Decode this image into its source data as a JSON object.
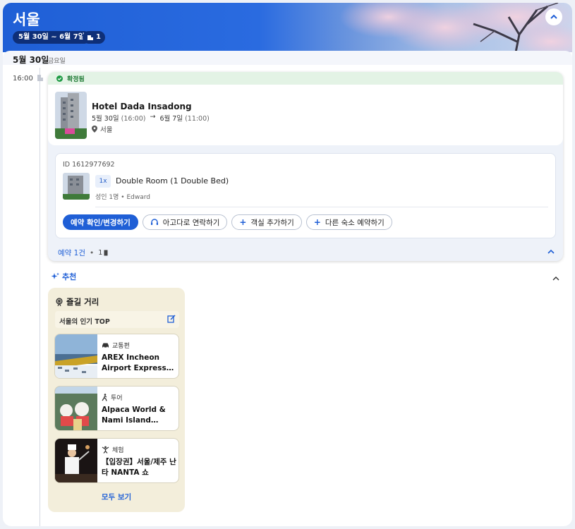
{
  "header": {
    "city": "서울",
    "date_range": "5월 30일 ~ 6월 7일",
    "rooms_count": "1"
  },
  "day": {
    "date": "5월 30일",
    "weekday": "금요일"
  },
  "timeline": {
    "time": "16:00"
  },
  "booking": {
    "status": "확정됨",
    "hotel_name": "Hotel Dada Insadong",
    "checkin_date": "5월 30일",
    "checkin_time": "(16:00)",
    "arrow": "→",
    "checkout_date": "6월 7일",
    "checkout_time": "(11:00)",
    "location": "서울",
    "reservation_id": "ID 1612977692",
    "room_qty": "1x",
    "room_name": "Double Room (1 Double Bed)",
    "guests": "성인 1명 • Edward",
    "buttons": {
      "confirm": "예약 확인/변경하기",
      "contact": "아고다로 연락하기",
      "add_room": "객실 추가하기",
      "other_stay": "다른 숙소 예약하기"
    },
    "count_label": "예약 1건",
    "count_dot": "•",
    "count_small": "1"
  },
  "recommend": {
    "title": "추천",
    "panel_title": "즐길 거리",
    "top_label": "서울의 인기 TOP",
    "items": [
      {
        "category": "교통편",
        "name": "AREX Incheon Airport Express…"
      },
      {
        "category": "투어",
        "name": "Alpaca World & Nami Island…"
      },
      {
        "category": "체험",
        "name": "【입장권】서울/제주 난타 NANTA 쇼"
      }
    ],
    "see_all": "모두 보기"
  },
  "colors": {
    "brand_blue": "#1f5fd6",
    "confirmed_green": "#1e7a34",
    "panel_beige": "#f3eedb"
  }
}
